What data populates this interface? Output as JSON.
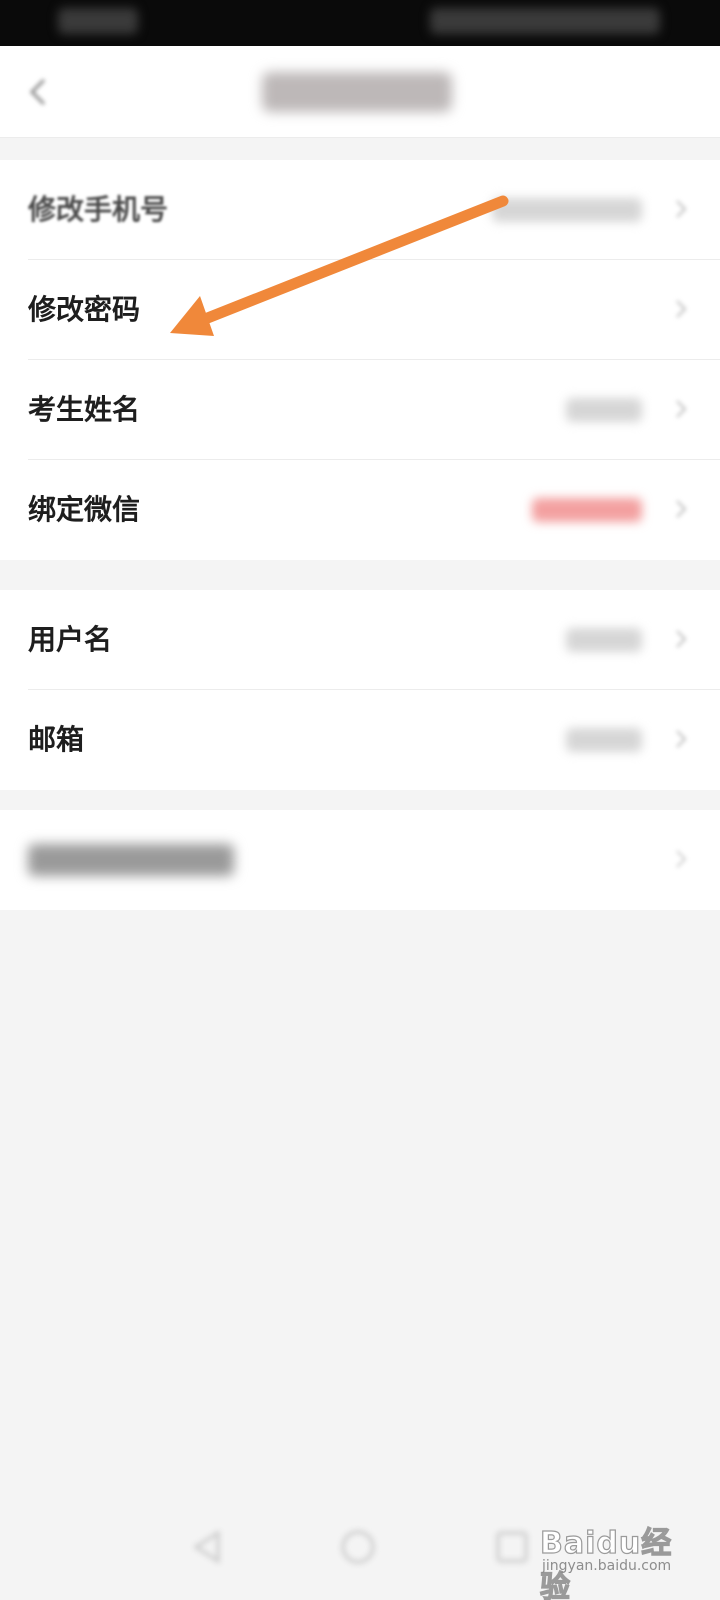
{
  "account_group": {
    "items": [
      {
        "label": "修改手机号",
        "has_value": true,
        "value_color": "gray",
        "blurred_label": true
      },
      {
        "label": "修改密码",
        "has_value": false,
        "value_color": "gray",
        "blurred_label": false
      },
      {
        "label": "考生姓名",
        "has_value": true,
        "value_color": "gray",
        "blurred_label": false
      },
      {
        "label": "绑定微信",
        "has_value": true,
        "value_color": "red",
        "blurred_label": false
      }
    ]
  },
  "profile_group": {
    "items": [
      {
        "label": "用户名",
        "has_value": true,
        "value_color": "gray"
      },
      {
        "label": "邮箱",
        "has_value": true,
        "value_color": "gray"
      }
    ]
  },
  "colors": {
    "background": "#f4f4f4",
    "card": "#ffffff",
    "annotation_arrow": "#f0883a",
    "unbound_value": "#e45454"
  },
  "watermark": {
    "brand": "Baidu经验",
    "site": "jingyan.baidu.com"
  },
  "icons": {
    "back": "chevron-left-icon",
    "row_chevron": "chevron-right-icon",
    "bottom_nav": [
      "back-triangle-icon",
      "home-circle-icon",
      "recents-square-icon"
    ]
  }
}
